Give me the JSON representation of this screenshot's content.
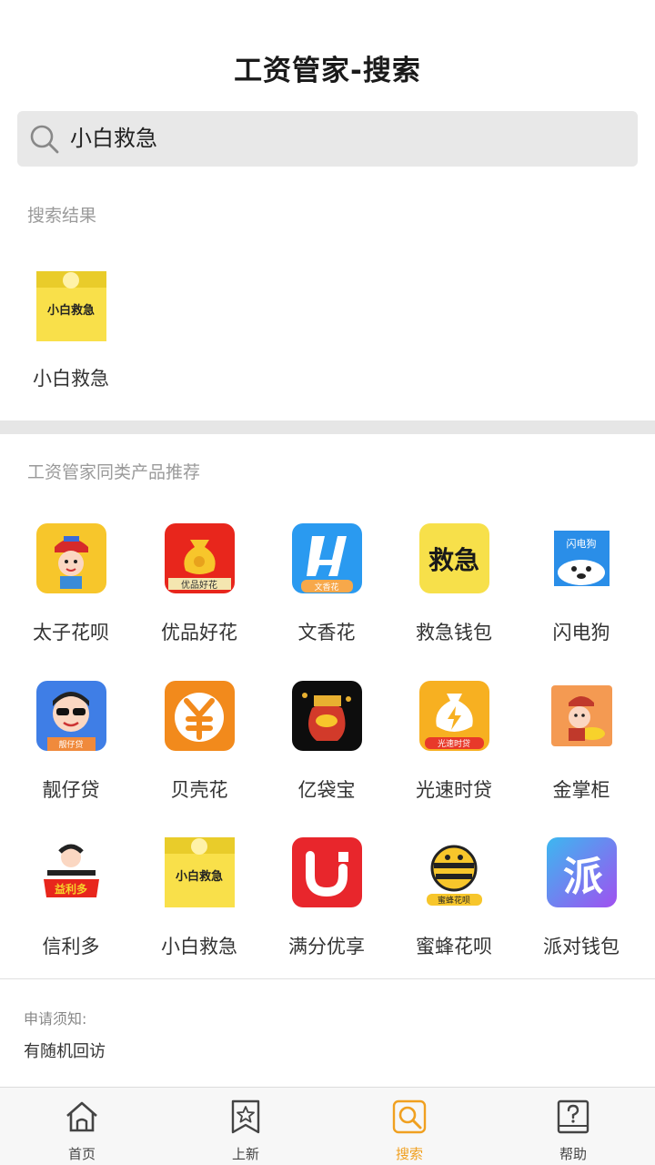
{
  "header": {
    "title": "工资管家-搜索"
  },
  "search": {
    "value": "小白救急",
    "icon": "search-icon"
  },
  "results": {
    "label": "搜索结果",
    "items": [
      {
        "name": "小白救急",
        "icon": "xiaobai-jiuji-logo",
        "icon_text": "小白救急"
      }
    ]
  },
  "recommend": {
    "label": "工资管家同类产品推荐",
    "items": [
      {
        "name": "太子花呗",
        "icon": "taizi-huabei-logo",
        "icon_text": ""
      },
      {
        "name": "优品好花",
        "icon": "youpin-haohua-logo",
        "icon_text": "优品好花"
      },
      {
        "name": "文香花",
        "icon": "wenxianghua-logo",
        "icon_text": "文香花"
      },
      {
        "name": "救急钱包",
        "icon": "jiuji-qianbao-logo",
        "icon_text": "救急"
      },
      {
        "name": "闪电狗",
        "icon": "shandiangou-logo",
        "icon_text": "闪电狗"
      },
      {
        "name": "靓仔贷",
        "icon": "liangzai-dai-logo",
        "icon_text": "靓仔贷"
      },
      {
        "name": "贝壳花",
        "icon": "beikehua-logo",
        "icon_text": ""
      },
      {
        "name": "亿袋宝",
        "icon": "yidaibao-logo",
        "icon_text": ""
      },
      {
        "name": "光速时贷",
        "icon": "guangsu-shidai-logo",
        "icon_text": "光速时贷"
      },
      {
        "name": "金掌柜",
        "icon": "jinzhanggui-logo",
        "icon_text": ""
      },
      {
        "name": "信利多",
        "icon": "xinliduo-logo",
        "icon_text": "益利多"
      },
      {
        "name": "小白救急",
        "icon": "xiaobai-jiuji-logo",
        "icon_text": "小白救急"
      },
      {
        "name": "满分优享",
        "icon": "manfen-youxiang-logo",
        "icon_text": ""
      },
      {
        "name": "蜜蜂花呗",
        "icon": "mifeng-huabei-logo",
        "icon_text": "蜜蜂花呗"
      },
      {
        "name": "派对钱包",
        "icon": "paidui-qianbao-logo",
        "icon_text": "派"
      }
    ]
  },
  "notice": {
    "title": "申请须知:",
    "text": "有随机回访"
  },
  "tabbar": {
    "active_color": "#f0a020",
    "items": [
      {
        "label": "首页",
        "icon": "home-icon"
      },
      {
        "label": "上新",
        "icon": "star-bookmark-icon"
      },
      {
        "label": "搜索",
        "icon": "search-icon",
        "active": true
      },
      {
        "label": "帮助",
        "icon": "help-icon"
      }
    ]
  }
}
